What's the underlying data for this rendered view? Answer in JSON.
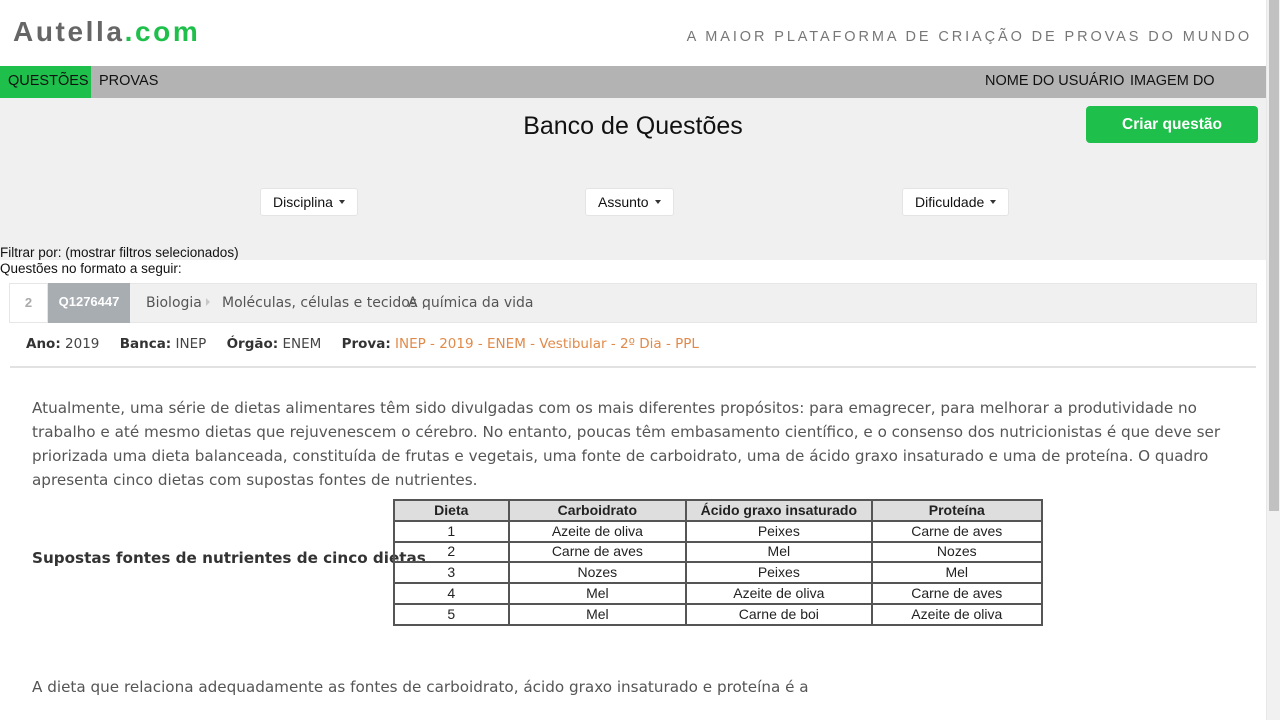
{
  "header": {
    "logo_main": "Autella",
    "logo_domain": ".com",
    "tagline": "A MAIOR PLATAFORMA DE CRIAÇÃO DE PROVAS DO MUNDO"
  },
  "nav": {
    "questoes": "QUESTÕES",
    "provas": "PROVAS",
    "user_name": "NOME DO USUÁRIO",
    "profile_image": "IMAGEM DO PERFIL"
  },
  "toolbar": {
    "title": "Banco de Questões",
    "create_button": "Criar questão",
    "filters": {
      "disciplina": "Disciplina",
      "assunto": "Assunto",
      "dificuldade": "Dificuldade"
    },
    "filter_by": "Filtrar por: (mostrar filtros selecionados)",
    "format_note": "Questões no formato a seguir:"
  },
  "question": {
    "number": "2",
    "id": "Q1276447",
    "discipline": "Biologia",
    "topics": "Moléculas, células e tecidos ,",
    "subtopic": "A química da vida",
    "meta": {
      "ano_label": "Ano:",
      "ano": "2019",
      "banca_label": "Banca:",
      "banca": "INEP",
      "orgao_label": "Órgão:",
      "orgao": "ENEM",
      "prova_label": "Prova:",
      "prova": "INEP - 2019 - ENEM - Vestibular - 2º Dia - PPL"
    },
    "text": "Atualmente, uma série de dietas alimentares têm sido divulgadas com os mais diferentes propósitos: para emagrecer, para melhorar a produtividade no trabalho e até mesmo dietas que rejuvenescem o cérebro. No entanto, poucas têm embasamento científico, e o consenso dos nutricionistas é que deve ser priorizada uma dieta balanceada, constituída de frutas e vegetais, uma fonte de carboidrato, uma de ácido graxo insaturado e uma de proteína. O quadro apresenta cinco dietas com supostas fontes de nutrientes.",
    "table_caption": "Supostas fontes de nutrientes de cinco dietas",
    "table": {
      "headers": [
        "Dieta",
        "Carboidrato",
        "Ácido graxo insaturado",
        "Proteína"
      ],
      "rows": [
        [
          "1",
          "Azeite de oliva",
          "Peixes",
          "Carne de aves"
        ],
        [
          "2",
          "Carne de aves",
          "Mel",
          "Nozes"
        ],
        [
          "3",
          "Nozes",
          "Peixes",
          "Mel"
        ],
        [
          "4",
          "Mel",
          "Azeite de oliva",
          "Carne de aves"
        ],
        [
          "5",
          "Mel",
          "Carne de boi",
          "Azeite de oliva"
        ]
      ]
    },
    "ask": "A dieta que relaciona adequadamente as fontes de carboidrato, ácido graxo insaturado e proteína é a"
  },
  "colors": {
    "brand_green": "#1ec04b",
    "nav_gray": "#b3b3b3",
    "link_orange": "#e08a4a"
  }
}
